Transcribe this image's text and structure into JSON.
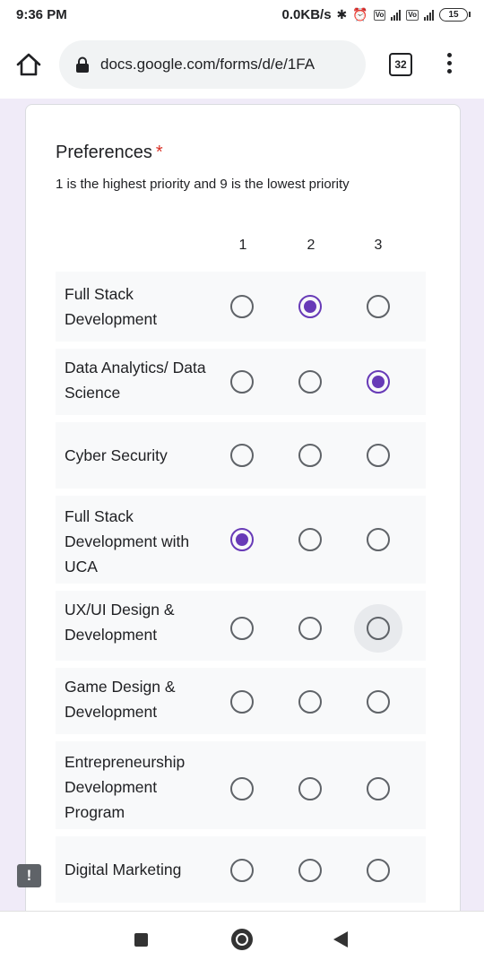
{
  "status_bar": {
    "time": "9:36 PM",
    "net_speed": "0.0KB/s",
    "network": "4G+",
    "battery": "15"
  },
  "browser": {
    "url": "docs.google.com/forms/d/e/1FA",
    "tab_count": "32"
  },
  "question": {
    "title": "Preferences",
    "required_mark": "*",
    "description": "1 is the highest priority and 9 is the lowest priority",
    "columns": [
      "1",
      "2",
      "3"
    ],
    "rows": [
      {
        "label": "Full Stack Development",
        "selected": "2"
      },
      {
        "label": "Data Analytics/ Data Science",
        "selected": "3"
      },
      {
        "label": "Cyber Security",
        "selected": null
      },
      {
        "label": "Full Stack Development with UCA",
        "selected": "1"
      },
      {
        "label": "UX/UI Design & Development",
        "selected": null,
        "focused": "3"
      },
      {
        "label": "Game Design & Development",
        "selected": null
      },
      {
        "label": "Entrepreneurship Development Program",
        "selected": null
      },
      {
        "label": "Digital Marketing",
        "selected": null
      }
    ]
  },
  "colors": {
    "accent": "#673ab7",
    "page_bg": "#f0ebf8",
    "required": "#d93025"
  }
}
